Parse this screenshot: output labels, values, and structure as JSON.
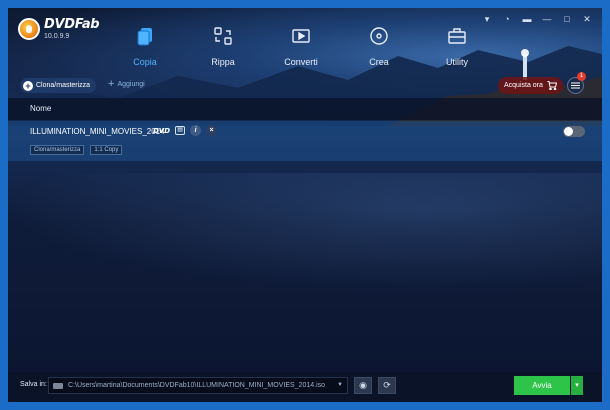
{
  "app": {
    "name": "DVDFab",
    "version": "10.0.9.9"
  },
  "nav": [
    {
      "label": "Copia",
      "icon": "copy-icon",
      "active": true
    },
    {
      "label": "Rippa",
      "icon": "rip-icon",
      "active": false
    },
    {
      "label": "Converti",
      "icon": "convert-icon",
      "active": false
    },
    {
      "label": "Crea",
      "icon": "create-disc-icon",
      "active": false
    },
    {
      "label": "Utility",
      "icon": "toolbox-icon",
      "active": false
    }
  ],
  "toolbar": {
    "clone_label": "Clona/masterizza",
    "add_label": "Aggiungi",
    "buy_label": "Acquista ora",
    "notification_count": "1"
  },
  "list": {
    "column_name": "Nome",
    "items": [
      {
        "title": "ILLUMINATION_MINI_MOVIES_2014",
        "format": "DVD",
        "info_glyph": "i",
        "close_glyph": "×",
        "tags": [
          "Clona/masterizza",
          "1:1 Copy"
        ],
        "enabled": false
      }
    ]
  },
  "bottom": {
    "save_label": "Salva in:",
    "path": "C:\\Users\\martina\\Documents\\DVDFab10\\ILLUMINATION_MINI_MOVIES_2014.iso",
    "start_label": "Avvia"
  },
  "colors": {
    "accent_active_tab": "#4fb3ff",
    "start_button": "#2ec449",
    "buy_button": "#6e1414",
    "window_border": "#1a6cc6"
  }
}
